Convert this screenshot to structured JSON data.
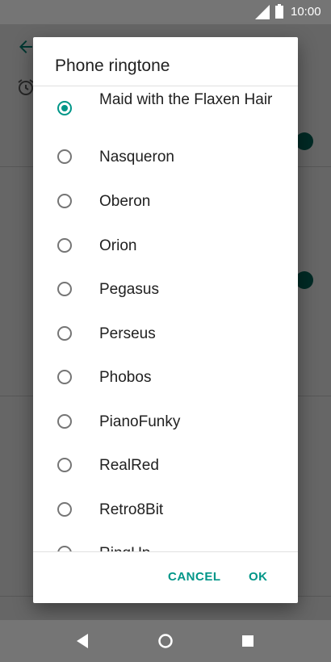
{
  "status_bar": {
    "time": "10:00"
  },
  "dialog": {
    "title": "Phone ringtone",
    "items": [
      {
        "label": "Maid with the Flaxen Hair",
        "checked": true
      },
      {
        "label": "Nasqueron",
        "checked": false
      },
      {
        "label": "Oberon",
        "checked": false
      },
      {
        "label": "Orion",
        "checked": false
      },
      {
        "label": "Pegasus",
        "checked": false
      },
      {
        "label": "Perseus",
        "checked": false
      },
      {
        "label": "Phobos",
        "checked": false
      },
      {
        "label": "PianoFunky",
        "checked": false
      },
      {
        "label": "RealRed",
        "checked": false
      },
      {
        "label": "Retro8Bit",
        "checked": false
      },
      {
        "label": "RingUp",
        "checked": false
      }
    ],
    "cancel_label": "CANCEL",
    "ok_label": "OK"
  },
  "colors": {
    "accent": "#009688",
    "scrim": "#757575",
    "text_primary": "#212121"
  }
}
